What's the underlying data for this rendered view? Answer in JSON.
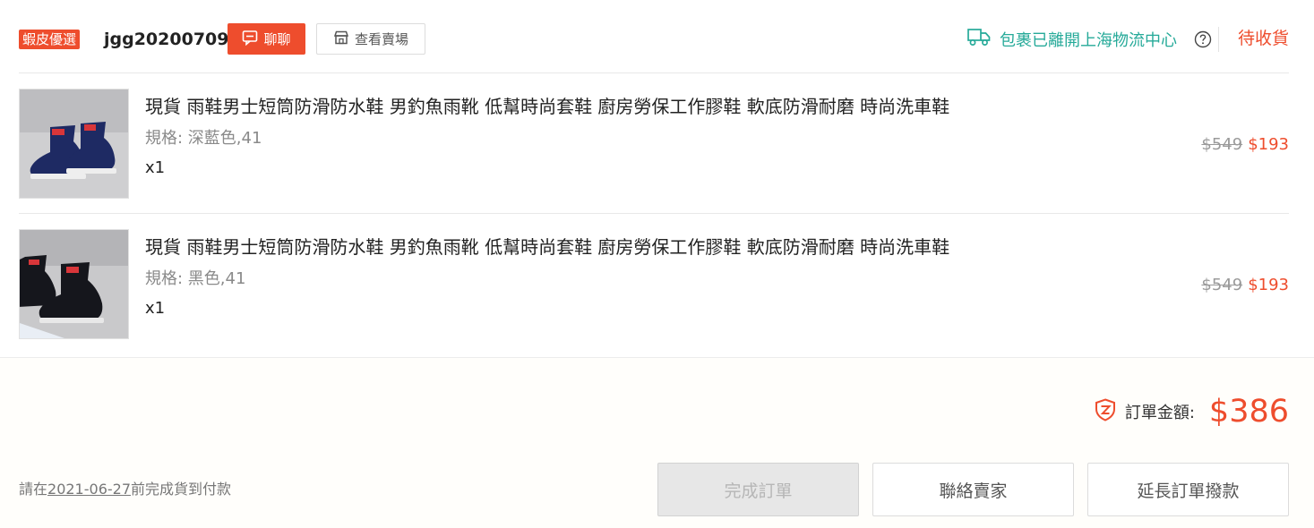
{
  "shop": {
    "badge": "蝦皮優選",
    "name": "jgg20200709",
    "chat_label": "聊聊",
    "view_shop_label": "查看賣場"
  },
  "shipping": {
    "status_text": "包裹已離開上海物流中心",
    "order_status": "待收貨"
  },
  "items": [
    {
      "title": "現貨 雨鞋男士短筒防滑防水鞋 男釣魚雨靴 低幫時尚套鞋 廚房勞保工作膠鞋 軟底防滑耐磨 時尚洗車鞋",
      "variant": "規格: 深藍色,41",
      "quantity": "x1",
      "original_price": "$549",
      "price": "$193",
      "boot_color": "#1e2a63"
    },
    {
      "title": "現貨 雨鞋男士短筒防滑防水鞋 男釣魚雨靴 低幫時尚套鞋 廚房勞保工作膠鞋 軟底防滑耐磨 時尚洗車鞋",
      "variant": "規格: 黑色,41",
      "quantity": "x1",
      "original_price": "$549",
      "price": "$193",
      "boot_color": "#15161c"
    }
  ],
  "summary": {
    "total_label": "訂單金額:",
    "total_value": "$386"
  },
  "footer": {
    "deadline_prefix": "請在",
    "deadline_date": "2021-06-27",
    "deadline_suffix": "前完成貨到付款",
    "complete_button": "完成訂單",
    "contact_button": "聯絡賣家",
    "extend_button": "延長訂單撥款"
  },
  "colors": {
    "accent": "#ee4d2d",
    "shipping": "#26aa99"
  }
}
